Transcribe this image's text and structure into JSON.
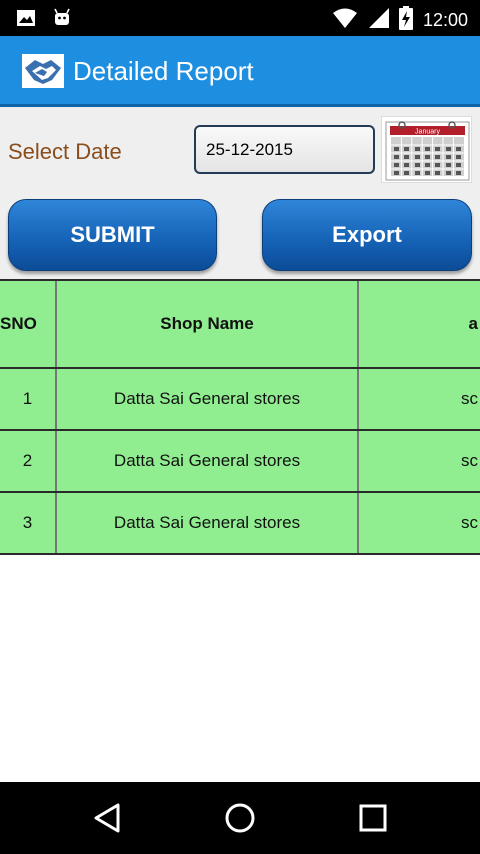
{
  "status_bar": {
    "time": "12:00",
    "left_icons": [
      "image-icon",
      "android-icon"
    ],
    "right_icons": [
      "wifi-icon",
      "signal-icon",
      "battery-charging-icon"
    ]
  },
  "app_bar": {
    "title": "Detailed Report",
    "logo_icon": "handshake-icon",
    "background": "#1e8fe0"
  },
  "filter": {
    "select_date_label": "Select Date",
    "date_value": "25-12-2015",
    "calendar_month": "January",
    "calendar_icon": "calendar-icon"
  },
  "actions": {
    "submit_label": "SUBMIT",
    "export_label": "Export"
  },
  "table": {
    "headers": [
      "SNO",
      "Shop Name",
      "a"
    ],
    "rows": [
      [
        "1",
        "Datta Sai General stores",
        "sc"
      ],
      [
        "2",
        "Datta Sai General stores",
        "sc"
      ],
      [
        "3",
        "Datta Sai General stores",
        "sc"
      ]
    ],
    "row_color": "#90ee90"
  },
  "nav_bar": {
    "buttons": [
      "back-icon",
      "home-icon",
      "recents-icon"
    ]
  }
}
